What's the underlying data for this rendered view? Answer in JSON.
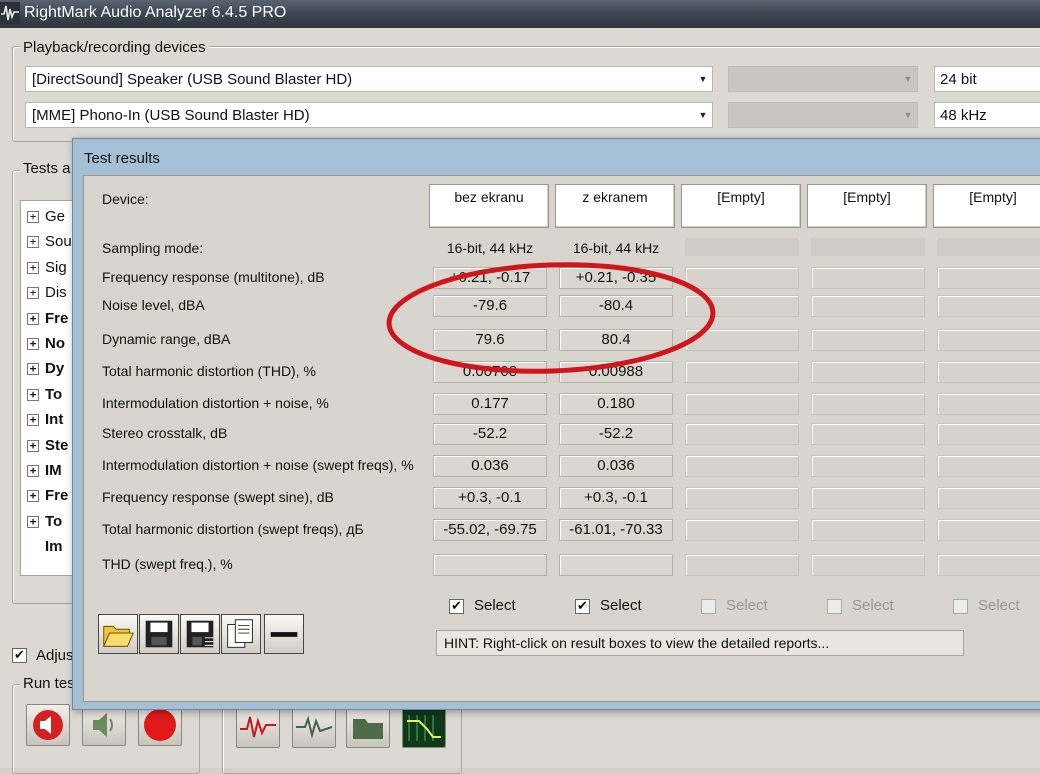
{
  "window": {
    "title": "RightMark Audio Analyzer 6.4.5 PRO"
  },
  "playback_group": {
    "legend": "Playback/recording devices",
    "playback_device": "[DirectSound] Speaker (USB Sound Blaster HD)",
    "recording_device": "[MME] Phono-In (USB Sound Blaster HD)",
    "bit_depth": "24 bit",
    "sample_rate": "48 kHz"
  },
  "tests_group": {
    "legend_visible": "Tests a",
    "tree_items": [
      {
        "label": "Ge",
        "bold": false,
        "expander": "+"
      },
      {
        "label": "Sou",
        "bold": false,
        "expander": "+"
      },
      {
        "label": "Sig",
        "bold": false,
        "expander": "+"
      },
      {
        "label": "Dis",
        "bold": false,
        "expander": "+"
      },
      {
        "label": "Fre",
        "bold": true,
        "expander": "+"
      },
      {
        "label": "No",
        "bold": true,
        "expander": "+"
      },
      {
        "label": "Dy",
        "bold": true,
        "expander": "+"
      },
      {
        "label": "To",
        "bold": true,
        "expander": "+"
      },
      {
        "label": "Int",
        "bold": true,
        "expander": "+"
      },
      {
        "label": "Ste",
        "bold": true,
        "expander": "+"
      },
      {
        "label": "IM",
        "bold": true,
        "expander": "+"
      },
      {
        "label": "Fre",
        "bold": true,
        "expander": "+"
      },
      {
        "label": "To",
        "bold": true,
        "expander": "+"
      },
      {
        "label": "Im",
        "bold": true,
        "expander": ""
      }
    ]
  },
  "adjust": {
    "label": "Adjus",
    "checked": true
  },
  "run_group": {
    "legend": "Run tes"
  },
  "dialog": {
    "title": "Test results",
    "device_label": "Device:",
    "devices": [
      "bez ekranu",
      "z ekranem",
      "[Empty]",
      "[Empty]",
      "[Empty]"
    ],
    "rows": [
      {
        "label": "Sampling mode:",
        "values": [
          "16-bit, 44 kHz",
          "16-bit, 44 kHz"
        ]
      },
      {
        "label": "Frequency response (multitone), dB",
        "values": [
          "+0.21, -0.17",
          "+0.21, -0.35"
        ]
      },
      {
        "label": "Noise level, dBA",
        "values": [
          "-79.6",
          "-80.4"
        ]
      },
      {
        "label": "Dynamic range, dBA",
        "values": [
          "79.6",
          "80.4"
        ]
      },
      {
        "label": "Total harmonic distortion (THD), %",
        "values": [
          "0.00708",
          "0.00988"
        ]
      },
      {
        "label": "Intermodulation distortion + noise, %",
        "values": [
          "0.177",
          "0.180"
        ]
      },
      {
        "label": "Stereo crosstalk, dB",
        "values": [
          "-52.2",
          "-52.2"
        ]
      },
      {
        "label": "Intermodulation distortion + noise (swept freqs), %",
        "values": [
          "0.036",
          "0.036"
        ]
      },
      {
        "label": "Frequency response (swept sine), dB",
        "values": [
          "+0.3, -0.1",
          "+0.3, -0.1"
        ]
      },
      {
        "label": "Total harmonic distortion (swept freqs), дБ",
        "values": [
          "-55.02, -69.75",
          "-61.01, -70.33"
        ]
      },
      {
        "label": "THD (swept freq.), %",
        "values": [
          "",
          ""
        ]
      }
    ],
    "select_label": "Select",
    "select_checked": [
      true,
      true,
      false,
      false,
      false
    ],
    "hint": "HINT: Right-click on result boxes to view the detailed reports...",
    "buttons": [
      "open-icon",
      "save-icon",
      "save-as-icon",
      "copy-icon",
      "remove-icon"
    ],
    "annotation_color": "#d0161a"
  }
}
